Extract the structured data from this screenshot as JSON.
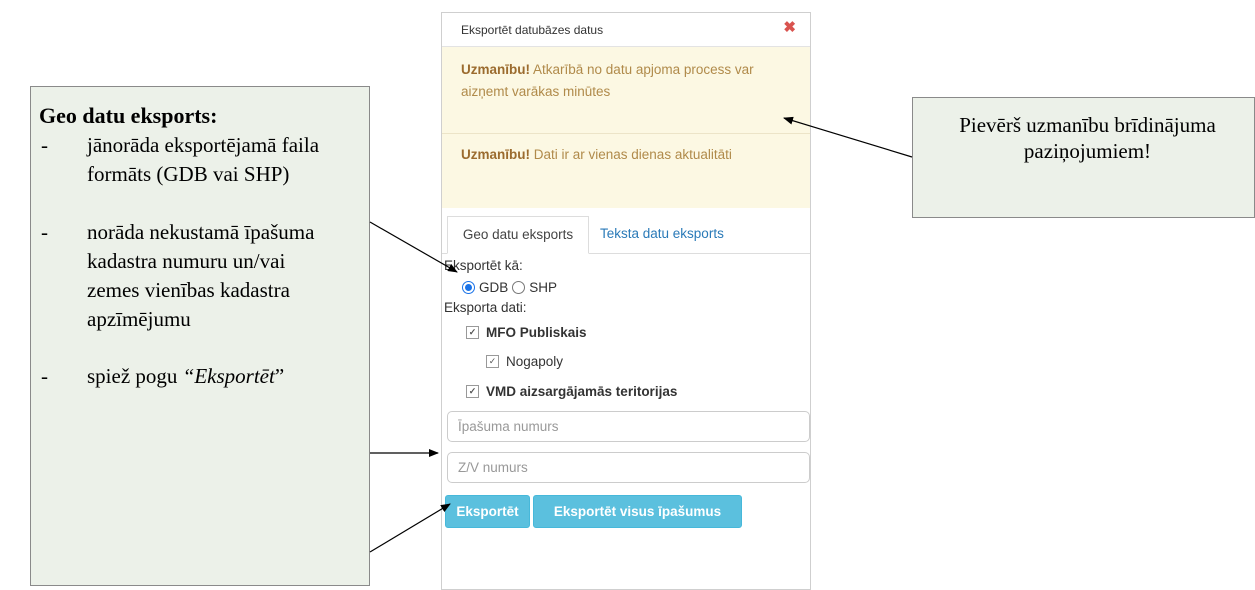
{
  "dialog": {
    "title": "Eksportēt datubāzes datus",
    "close_glyph": "✖",
    "alerts": [
      {
        "strong": "Uzmanību!",
        "text": " Atkarībā no datu apjoma process var aizņemt varākas minūtes"
      },
      {
        "strong": "Uzmanību!",
        "text": " Dati ir ar vienas dienas aktualitāti"
      }
    ],
    "tabs": [
      "Geo datu eksports",
      "Teksta datu eksports"
    ],
    "export_as_label": "Eksportēt kā:",
    "formats": [
      {
        "label": "GDB",
        "checked": true
      },
      {
        "label": "SHP",
        "checked": false
      }
    ],
    "export_data_label": "Eksporta dati:",
    "layers": [
      {
        "label": "MFO Publiskais",
        "bold": true,
        "checked": true
      },
      {
        "label": "Nogapoly",
        "bold": false,
        "checked": true
      },
      {
        "label": "VMD aizsargājamās teritorijas",
        "bold": true,
        "checked": true
      }
    ],
    "property_placeholder": "Īpašuma numurs",
    "land_unit_placeholder": "Z/V numurs",
    "export_button": "Eksportēt",
    "export_all_button": "Eksportēt visus īpašumus"
  },
  "left_callout": {
    "title": "Geo datu eksports:",
    "items": [
      {
        "dash": "-",
        "text": "jānorāda eksportējamā faila formāts (GDB vai SHP)"
      },
      {
        "dash": "-",
        "text": "norāda nekustamā īpašuma kadastra numuru un/vai zemes vienības kadastra apzīmējumu"
      },
      {
        "dash": "-",
        "text_pre": "spiež pogu ",
        "text_em": "“Eksportēt",
        "text_post": "”"
      }
    ]
  },
  "right_callout": {
    "text": "Pievērš uzmanību brīdinājuma paziņojumiem!"
  },
  "colors": {
    "callout_bg": "#ecf1e9",
    "alert_bg": "#fcf8e3",
    "button_bg": "#5bc0de",
    "tab_link": "#2a7ab8",
    "close": "#d9534f"
  }
}
